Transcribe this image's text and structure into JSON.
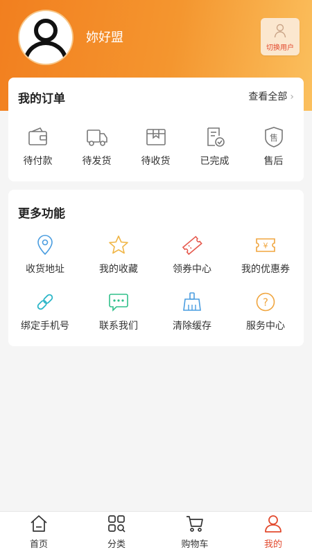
{
  "header": {
    "username": "妳好盟",
    "switch_user_label": "切换用户",
    "gradient_start": "#f27f1f",
    "gradient_end": "#fbc05e"
  },
  "orders": {
    "title": "我的订单",
    "view_all": "查看全部",
    "items": [
      {
        "label": "待付款",
        "icon": "wallet-icon"
      },
      {
        "label": "待发货",
        "icon": "truck-icon"
      },
      {
        "label": "待收货",
        "icon": "package-icon"
      },
      {
        "label": "已完成",
        "icon": "completed-doc-icon"
      },
      {
        "label": "售后",
        "icon": "after-sales-shield-icon"
      }
    ]
  },
  "more": {
    "title": "更多功能",
    "items": [
      {
        "label": "收货地址",
        "icon": "location-pin-icon",
        "color": "#4a9de0"
      },
      {
        "label": "我的收藏",
        "icon": "star-icon",
        "color": "#f0b545"
      },
      {
        "label": "领券中心",
        "icon": "ticket-icon",
        "color": "#e5574b"
      },
      {
        "label": "我的优惠券",
        "icon": "coupon-yen-icon",
        "color": "#f0a53e"
      },
      {
        "label": "绑定手机号",
        "icon": "link-icon",
        "color": "#2cb6c8"
      },
      {
        "label": "联系我们",
        "icon": "chat-icon",
        "color": "#2fbf8a"
      },
      {
        "label": "清除缓存",
        "icon": "broom-icon",
        "color": "#4a9de0"
      },
      {
        "label": "服务中心",
        "icon": "help-circle-icon",
        "color": "#f0a53e"
      }
    ]
  },
  "tabbar": {
    "active_color": "#e24a2e",
    "items": [
      {
        "label": "首页",
        "icon": "home-icon"
      },
      {
        "label": "分类",
        "icon": "category-grid-icon"
      },
      {
        "label": "购物车",
        "icon": "cart-icon"
      },
      {
        "label": "我的",
        "icon": "profile-icon",
        "active": true
      }
    ]
  }
}
